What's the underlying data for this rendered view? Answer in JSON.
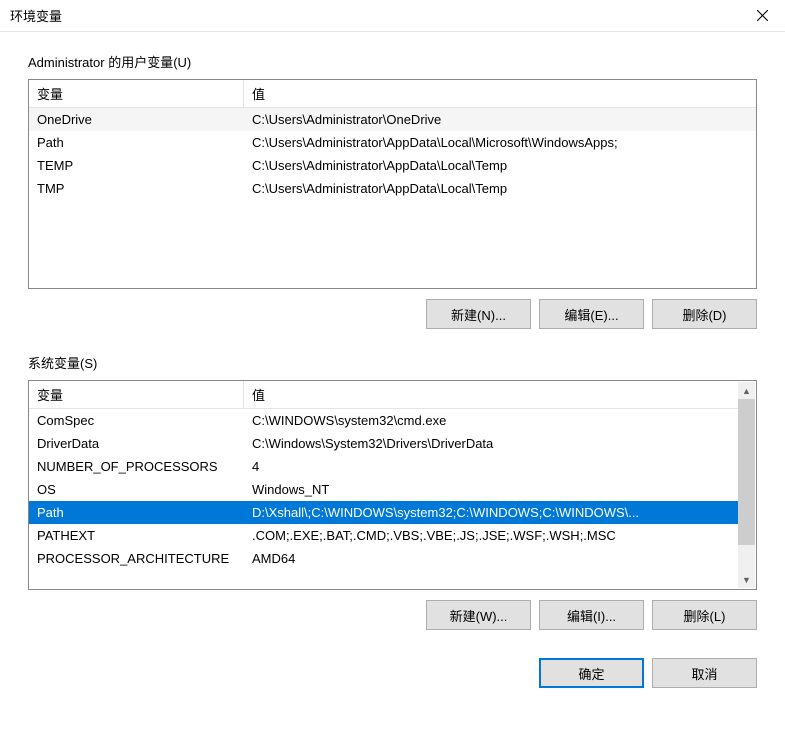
{
  "title": "环境变量",
  "user_section_label": "Administrator 的用户变量(U)",
  "system_section_label": "系统变量(S)",
  "columns": {
    "var": "变量",
    "val": "值"
  },
  "user_vars": [
    {
      "name": "OneDrive",
      "value": "C:\\Users\\Administrator\\OneDrive",
      "alt": true
    },
    {
      "name": "Path",
      "value": "C:\\Users\\Administrator\\AppData\\Local\\Microsoft\\WindowsApps;"
    },
    {
      "name": "TEMP",
      "value": "C:\\Users\\Administrator\\AppData\\Local\\Temp"
    },
    {
      "name": "TMP",
      "value": "C:\\Users\\Administrator\\AppData\\Local\\Temp"
    }
  ],
  "system_vars": [
    {
      "name": "ComSpec",
      "value": "C:\\WINDOWS\\system32\\cmd.exe"
    },
    {
      "name": "DriverData",
      "value": "C:\\Windows\\System32\\Drivers\\DriverData"
    },
    {
      "name": "NUMBER_OF_PROCESSORS",
      "value": "4"
    },
    {
      "name": "OS",
      "value": "Windows_NT"
    },
    {
      "name": "Path",
      "value": "D:\\Xshall\\;C:\\WINDOWS\\system32;C:\\WINDOWS;C:\\WINDOWS\\...",
      "selected": true
    },
    {
      "name": "PATHEXT",
      "value": ".COM;.EXE;.BAT;.CMD;.VBS;.VBE;.JS;.JSE;.WSF;.WSH;.MSC"
    },
    {
      "name": "PROCESSOR_ARCHITECTURE",
      "value": "AMD64"
    }
  ],
  "buttons": {
    "user_new": "新建(N)...",
    "user_edit": "编辑(E)...",
    "user_delete": "删除(D)",
    "sys_new": "新建(W)...",
    "sys_edit": "编辑(I)...",
    "sys_delete": "删除(L)",
    "ok": "确定",
    "cancel": "取消"
  }
}
